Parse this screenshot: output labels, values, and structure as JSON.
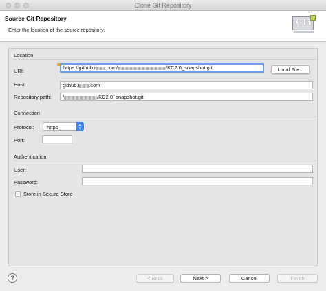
{
  "window": {
    "title": "Clone Git Repository"
  },
  "header": {
    "title": "Source Git Repository",
    "description": "Enter the location of the source repository.",
    "logo_text": "GIT"
  },
  "location": {
    "group_label": "Location",
    "uri_label": "URI:",
    "uri_prefix": "https://github.i",
    "uri_mid": ".com/",
    "uri_suffix": "/KC2.0_snapshot.git",
    "local_file_button": "Local File...",
    "host_label": "Host:",
    "host_prefix": "github.i",
    "host_suffix": ".com",
    "repo_path_label": "Repository path:",
    "repo_path_prefix": "/",
    "repo_path_suffix": "/KC2.0_snapshot.git"
  },
  "connection": {
    "group_label": "Connection",
    "protocol_label": "Protocol:",
    "protocol_value": "https",
    "port_label": "Port:",
    "port_value": ""
  },
  "authentication": {
    "group_label": "Authentication",
    "user_label": "User:",
    "user_value": "",
    "password_label": "Password:",
    "password_value": "",
    "store_label": "Store in Secure Store",
    "store_checked": false
  },
  "footer": {
    "help_symbol": "?",
    "back_label": "< Back",
    "next_label": "Next >",
    "cancel_label": "Cancel",
    "finish_label": "Finish"
  },
  "colors": {
    "accent": "#3b86f7",
    "focus": "#6aa0e8"
  }
}
